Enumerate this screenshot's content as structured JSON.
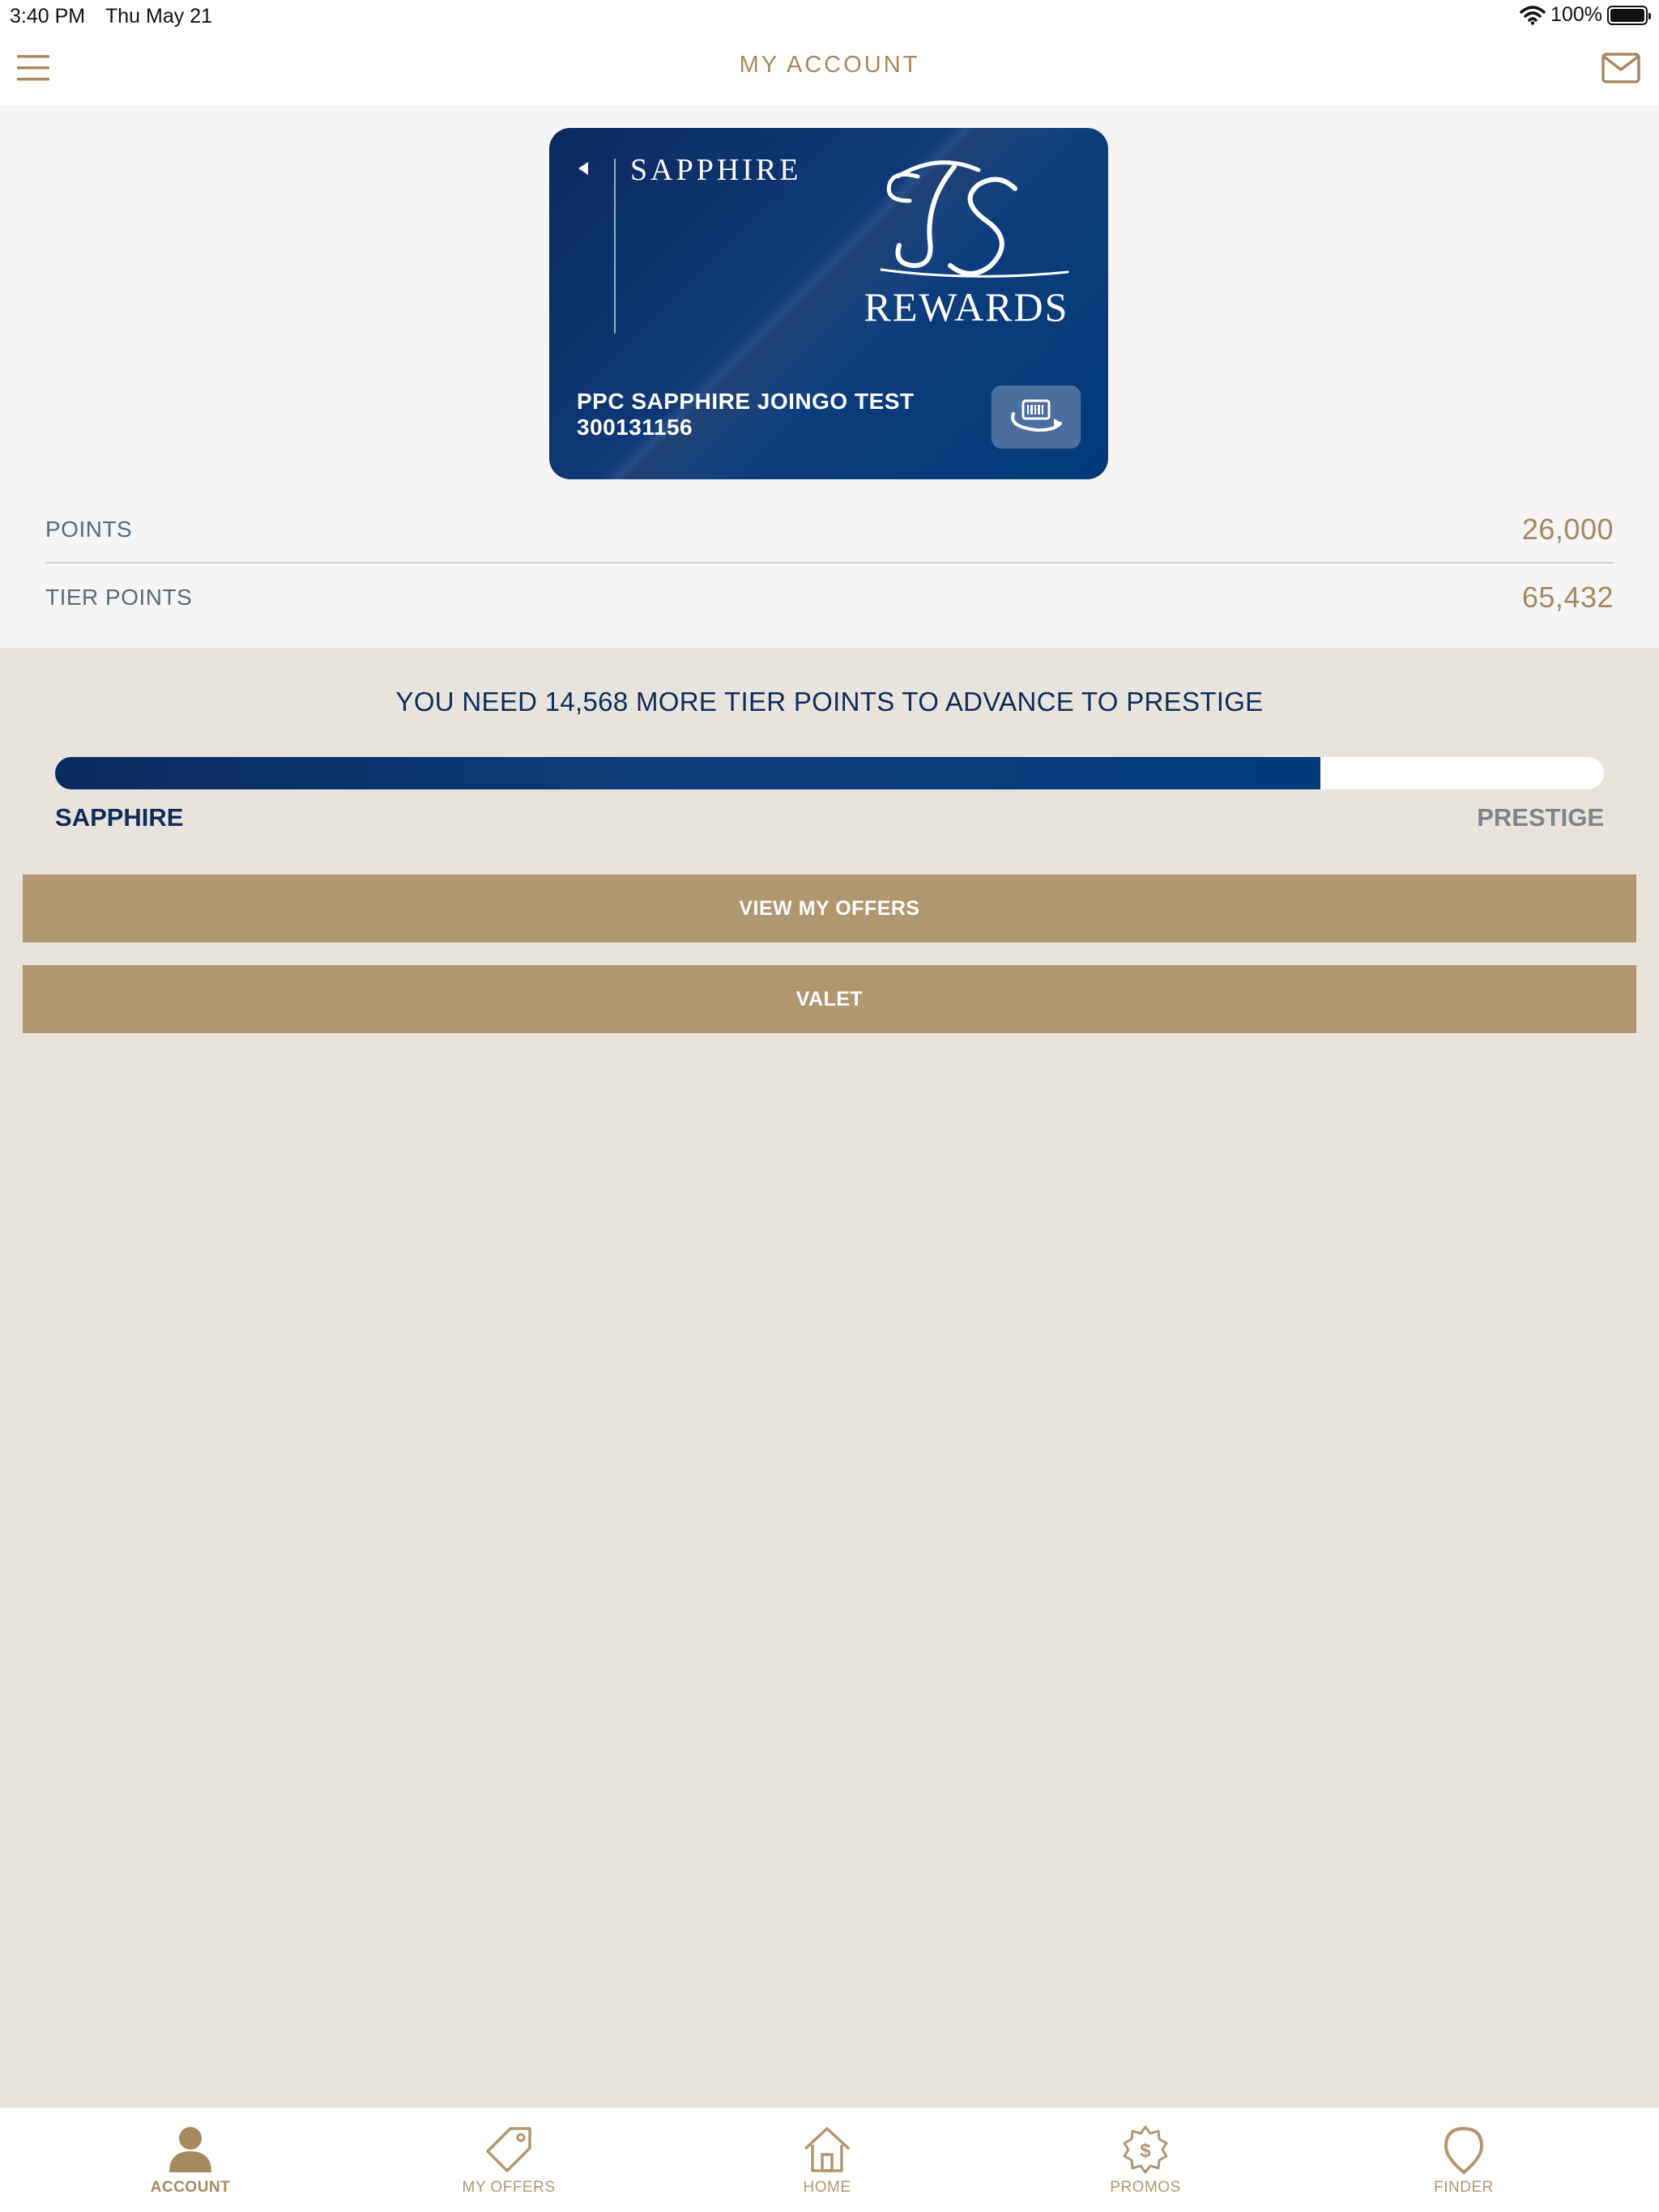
{
  "status_bar": {
    "time": "3:40 PM",
    "date": "Thu May 21",
    "battery": "100%"
  },
  "nav": {
    "title": "MY ACCOUNT"
  },
  "card": {
    "tier_name": "SAPPHIRE",
    "logo_text": "REWARDS",
    "member_name": "PPC SAPPHIRE JOINGO TEST",
    "member_number": "300131156"
  },
  "points": {
    "points_label": "POINTS",
    "points_value": "26,000",
    "tier_points_label": "TIER POINTS",
    "tier_points_value": "65,432"
  },
  "progress": {
    "message": "YOU NEED 14,568 MORE TIER POINTS TO ADVANCE TO PRESTIGE",
    "fraction": 0.817,
    "current_tier": "SAPPHIRE",
    "next_tier": "PRESTIGE"
  },
  "buttons": {
    "view_offers": "VIEW MY OFFERS",
    "valet": "VALET"
  },
  "tabs": [
    {
      "label": "ACCOUNT",
      "icon": "account-icon",
      "active": true
    },
    {
      "label": "MY OFFERS",
      "icon": "tag-icon",
      "active": false
    },
    {
      "label": "HOME",
      "icon": "home-icon",
      "active": false
    },
    {
      "label": "PROMOS",
      "icon": "promo-badge-icon",
      "active": false
    },
    {
      "label": "FINDER",
      "icon": "location-pin-icon",
      "active": false
    }
  ],
  "colors": {
    "accent_gold": "#a8885d",
    "button_gold": "#b0976f",
    "navy": "#0e2d5a",
    "background": "#e8e3dc"
  }
}
